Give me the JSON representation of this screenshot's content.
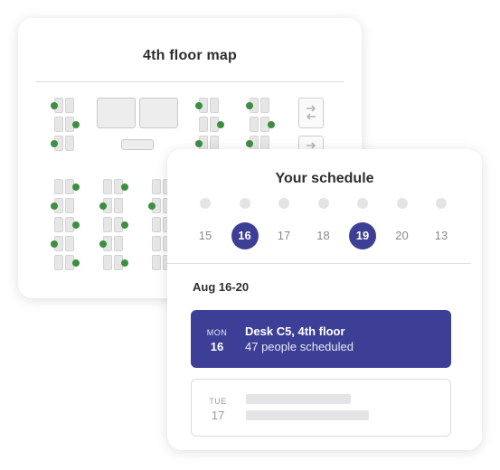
{
  "floor_map": {
    "title": "4th floor map"
  },
  "schedule": {
    "title": "Your schedule",
    "days": [
      {
        "date": "15",
        "selected": false
      },
      {
        "date": "16",
        "selected": true
      },
      {
        "date": "17",
        "selected": false
      },
      {
        "date": "18",
        "selected": false
      },
      {
        "date": "19",
        "selected": true
      },
      {
        "date": "20",
        "selected": false
      },
      {
        "date": "13",
        "selected": false
      }
    ],
    "range_label": "Aug 16-20",
    "bookings": [
      {
        "day_of_week": "MON",
        "date": "16",
        "title": "Desk C5, 4th floor",
        "subtitle": "47 people scheduled"
      },
      {
        "day_of_week": "TUE",
        "date": "17"
      }
    ]
  },
  "colors": {
    "accent": "#3d3f97",
    "available": "#3e8e41"
  }
}
